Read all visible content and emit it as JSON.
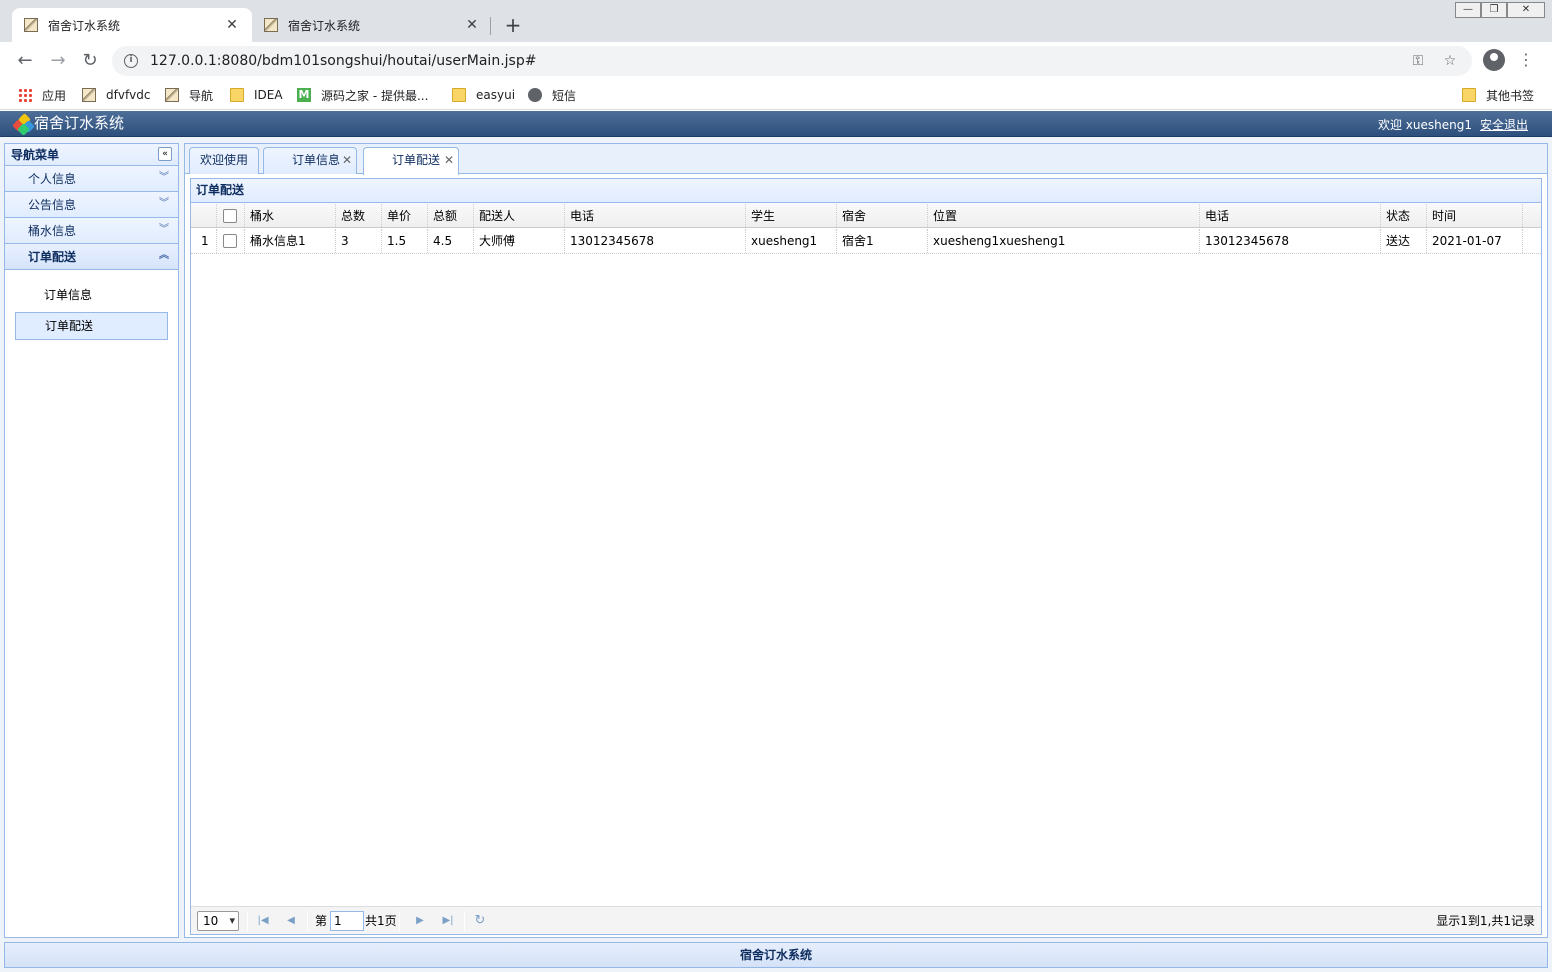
{
  "browser": {
    "tabs": [
      {
        "title": "宿舍订水系统"
      },
      {
        "title": "宿舍订水系统"
      }
    ],
    "url": "127.0.0.1:8080/bdm101songshui/houtai/userMain.jsp#",
    "bookmarks": [
      "应用",
      "dfvfvdc",
      "导航",
      "IDEA",
      "源码之家 - 提供最...",
      "easyui",
      "短信"
    ],
    "other_bookmarks": "其他书签"
  },
  "app": {
    "title": "宿舍订水系统",
    "welcome": "欢迎 xuesheng1",
    "logout": "安全退出",
    "footer": "宿舍订水系统"
  },
  "sidebar": {
    "title": "导航菜单",
    "sections": [
      {
        "label": "个人信息"
      },
      {
        "label": "公告信息"
      },
      {
        "label": "桶水信息"
      },
      {
        "label": "订单配送"
      }
    ],
    "items": [
      {
        "label": "订单信息"
      },
      {
        "label": "订单配送"
      }
    ]
  },
  "content_tabs": [
    {
      "label": "欢迎使用"
    },
    {
      "label": "订单信息"
    },
    {
      "label": "订单配送"
    }
  ],
  "panel": {
    "title": "订单配送"
  },
  "grid": {
    "columns": [
      "桶水",
      "总数",
      "单价",
      "总额",
      "配送人",
      "电话",
      "学生",
      "宿舍",
      "位置",
      "电话",
      "状态",
      "时间"
    ],
    "rows": [
      {
        "num": "1",
        "cells": [
          "桶水信息1",
          "3",
          "1.5",
          "4.5",
          "大师傅",
          "13012345678",
          "xuesheng1",
          "宿舍1",
          "xuesheng1xuesheng1",
          "13012345678",
          "送达",
          "2021-01-07"
        ]
      }
    ]
  },
  "pager": {
    "page_size": "10",
    "page_prefix": "第",
    "page_value": "1",
    "page_total": "共1页",
    "info": "显示1到1,共1记录"
  }
}
